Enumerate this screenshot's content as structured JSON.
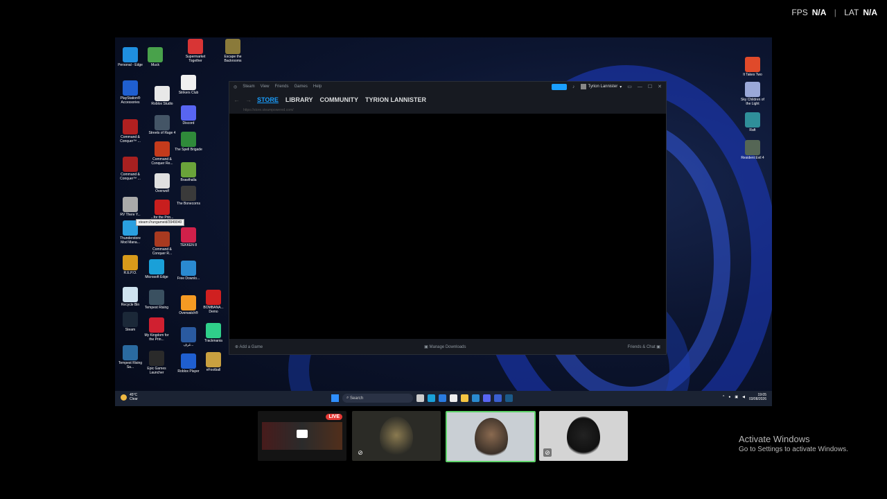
{
  "stats": {
    "fps_label": "FPS",
    "fps_value": "N/A",
    "lat_label": "LAT",
    "lat_value": "N/A",
    "separator": "|"
  },
  "desktop_icons": [
    {
      "label": "Personal - Edge",
      "color": "#1f8fe0"
    },
    {
      "label": "Muck",
      "color": "#49a24b"
    },
    {
      "label": "Supermarket Together",
      "color": "#d83535"
    },
    {
      "label": "Escape the Backrooms",
      "color": "#8a7a3a"
    },
    {
      "label": "PlayStation® Accessories",
      "color": "#1f5fd0"
    },
    {
      "label": "Roblox Studio",
      "color": "#e8e8e8"
    },
    {
      "label": "Strikers Club",
      "color": "#f0f0f0"
    },
    {
      "label": "Command & Conquer™ ...",
      "color": "#b02020"
    },
    {
      "label": "Streets of Rage 4",
      "color": "#445566"
    },
    {
      "label": "Discord",
      "color": "#5865f2"
    },
    {
      "label": "Command & Conquer Re...",
      "color": "#c43b1c"
    },
    {
      "label": "The Spell Brigade",
      "color": "#2f8a3a"
    },
    {
      "label": "Command & Conquer™ ...",
      "color": "#a82020"
    },
    {
      "label": "Brawlhalla",
      "color": "#6aa33a"
    },
    {
      "label": "Overwolf",
      "color": "#e0e0e0"
    },
    {
      "label": "The Bonecorns",
      "color": "#3a3a3a"
    },
    {
      "label": "RV There Y...",
      "color": "#aaaaaa"
    },
    {
      "label": "...for the Prin...",
      "color": "#c81e1e"
    },
    {
      "label": "Thunderstore Mod Mana...",
      "color": "#2a9fe0"
    },
    {
      "label": "TEKKEN 8",
      "color": "#d0204a"
    },
    {
      "label": "Command & Conquer R...",
      "color": "#a83a20"
    },
    {
      "label": "R.E.P.O.",
      "color": "#d89a1a"
    },
    {
      "label": "Microsoft Edge",
      "color": "#1aa0d8"
    },
    {
      "label": "Free Downlo...",
      "color": "#2a8ad0"
    },
    {
      "label": "Recycle Bin",
      "color": "#cfe3f0"
    },
    {
      "label": "Tempest Rising",
      "color": "#3a5060"
    },
    {
      "label": "Overwatch®",
      "color": "#f59a23"
    },
    {
      "label": "BOMBANA... Demo",
      "color": "#d02020"
    },
    {
      "label": "Steam",
      "color": "#1b2838"
    },
    {
      "label": "My Kingdom for the Prin...",
      "color": "#d02030"
    },
    {
      "label": "غرف...",
      "color": "#2a5aa0"
    },
    {
      "label": "Trackmania",
      "color": "#2fcf8a"
    },
    {
      "label": "Tempest Rising Sa...",
      "color": "#2a6aa0"
    },
    {
      "label": "Epic Games Launcher",
      "color": "#2a2a2a"
    },
    {
      "label": "Roblox Player",
      "color": "#1f5fd0"
    },
    {
      "label": "eFootball",
      "color": "#c8a040"
    },
    {
      "label": "It Takes Two",
      "color": "#e04a2a"
    },
    {
      "label": "Sky Children of the Light",
      "color": "#9aa8d8"
    },
    {
      "label": "Raft",
      "color": "#2f8f9a"
    },
    {
      "label": "Resident Evil 4",
      "color": "#556655"
    }
  ],
  "tooltip": "steam://rungameid/3949040",
  "steam": {
    "menu": [
      "Steam",
      "View",
      "Friends",
      "Games",
      "Help"
    ],
    "user": "Tyrion Lannister",
    "tabs": [
      "STORE",
      "LIBRARY",
      "COMMUNITY",
      "TYRION LANNISTER"
    ],
    "url": "https://store.steampowered.com/",
    "add_game": "Add a Game",
    "manage_downloads": "Manage Downloads",
    "friends_chat": "Friends & Chat"
  },
  "taskbar": {
    "temp": "45°C",
    "condition": "Clear",
    "search": "Search",
    "time": "19:05",
    "date": "03/08/2026"
  },
  "thumbnails": {
    "live": "LIVE"
  },
  "activate": {
    "title": "Activate Windows",
    "subtitle": "Go to Settings to activate Windows."
  }
}
